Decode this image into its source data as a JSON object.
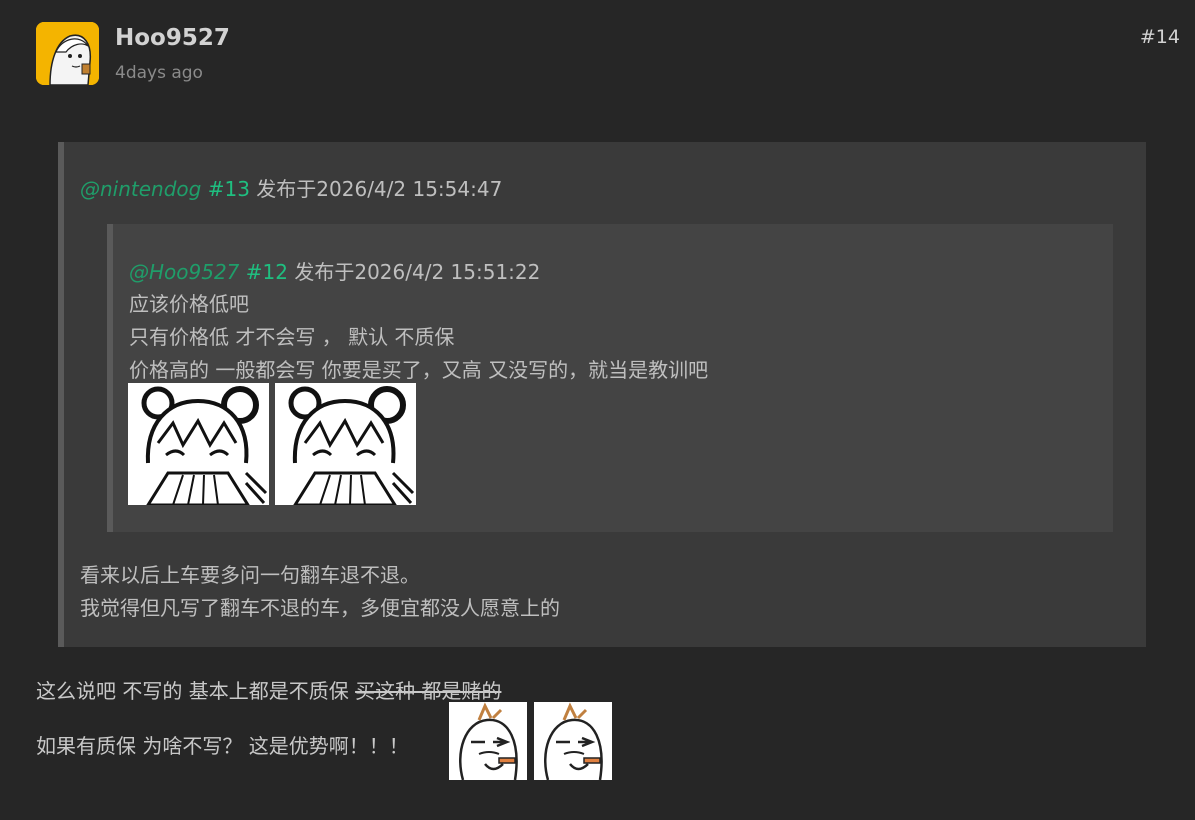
{
  "post": {
    "username": "Hoo9527",
    "time": "4days ago",
    "floor": "#14"
  },
  "quote_outer": {
    "mention": "@nintendog",
    "ref": "#13",
    "published": "发布于2026/4/2 15:54:47",
    "lines": [
      "看来以后上车要多问一句翻车退不退。",
      "我觉得但凡写了翻车不退的车，多便宜都没人愿意上的"
    ]
  },
  "quote_inner": {
    "mention": "@Hoo9527",
    "ref": "#12",
    "published": "发布于2026/4/2 15:51:22",
    "lines": [
      "应该价格低吧",
      "只有价格低 才不会写 ， 默认 不质保",
      "价格高的 一般都会写 你要是买了，又高 又没写的，就当是教训吧"
    ]
  },
  "reply": {
    "line1_plain": "这么说吧 不写的 基本上都是不质保 ",
    "line1_strike": "买这种 都是赌的",
    "line2": "如果有质保 为啥不写？ 这是优势啊！！！"
  },
  "icons": {
    "avatar": "anime-avatar-icon",
    "sticker_girl": "anime-girl-fan-sticker",
    "sticker_smoke": "smoking-character-sticker"
  }
}
